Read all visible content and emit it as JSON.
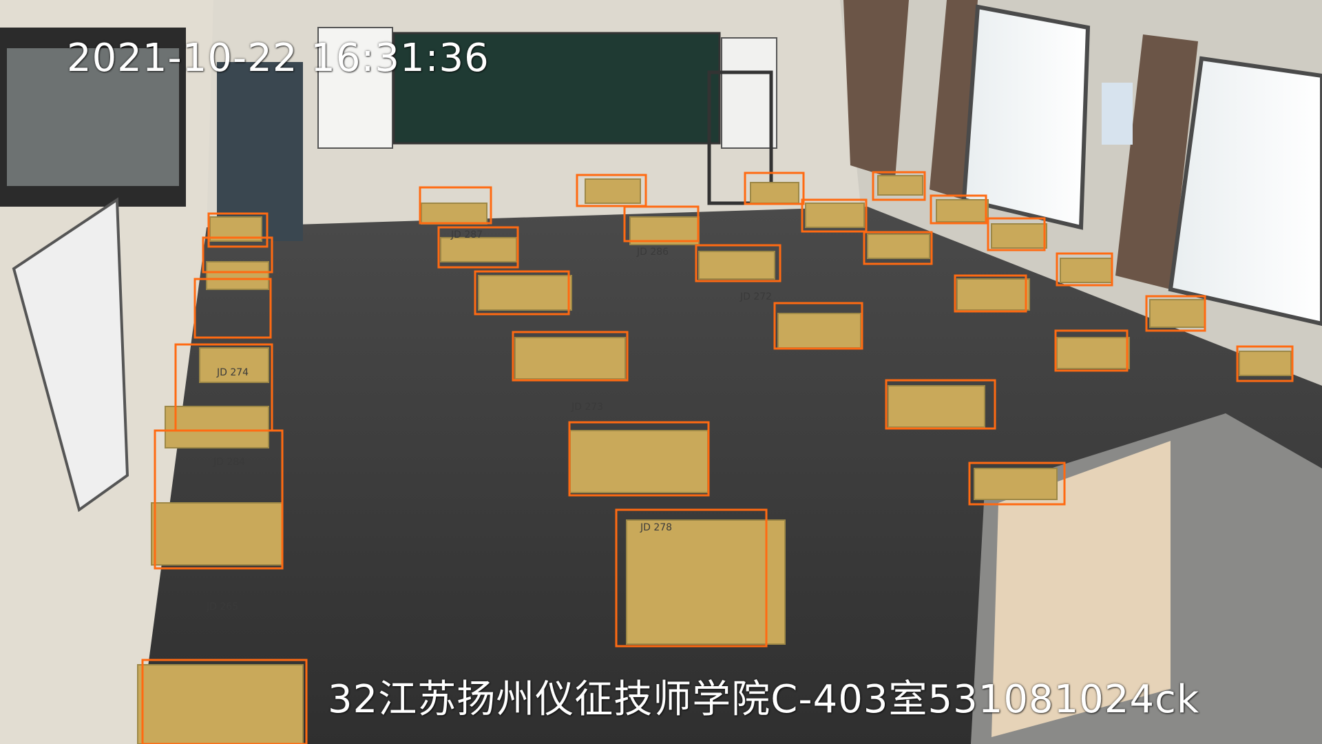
{
  "overlay": {
    "timestamp": "2021-10-22 16:31:36",
    "camera_label": "32江苏扬州仪征技师学院C-403室531081024ck"
  },
  "colors": {
    "detection_box": "#ff6a12",
    "osd_text": "#ffffff",
    "floor": "#3a3a3a",
    "wall": "#dedbd2",
    "desktop": "#c9a95a",
    "blackboard": "#1f3a33"
  },
  "scene_labels": {
    "desk_codes": [
      "JD 287",
      "JD 286",
      "JD 272",
      "JD 273",
      "JD 274",
      "JD 284",
      "JD 265",
      "JD 278"
    ]
  },
  "detections": {
    "object": "desk",
    "count": 29
  }
}
